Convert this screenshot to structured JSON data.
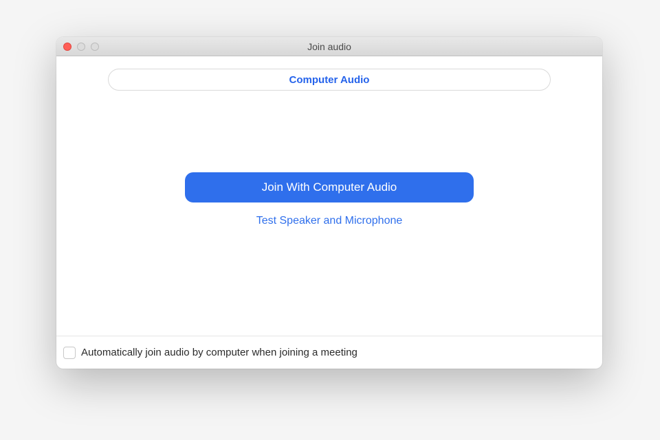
{
  "window": {
    "title": "Join audio"
  },
  "tab": {
    "label": "Computer Audio"
  },
  "actions": {
    "join_button": "Join With Computer Audio",
    "test_link": "Test Speaker and Microphone"
  },
  "footer": {
    "auto_join_label": "Automatically join audio by computer when joining a meeting",
    "auto_join_checked": false
  }
}
